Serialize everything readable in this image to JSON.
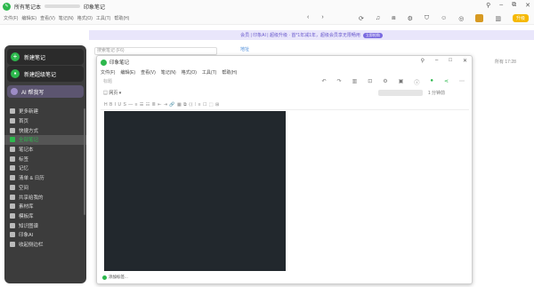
{
  "app": {
    "title": "所有笔记本",
    "window_title": "印象笔记"
  },
  "menu": [
    "文件(F)",
    "编辑(E)",
    "查看(V)",
    "笔记(N)",
    "格式(O)",
    "工具(T)",
    "帮助(H)"
  ],
  "topbar": {
    "upgrade": "升级"
  },
  "banner": {
    "text": "会员 | 印象AI | 超级升级 · 首*1年减1年，超级会员享无限畅用",
    "tag": "立即抢购"
  },
  "sidebar": {
    "new_note": "新建笔记",
    "new_super_note": "新建超级笔记",
    "ai": "AI 帮我写",
    "items": [
      "更多新建",
      "首页",
      "快捷方式",
      "全部笔记",
      "笔记本",
      "标签",
      "记忆",
      "清单 & 日历",
      "空间",
      "共享给我的",
      "素材库",
      "模板库",
      "知识图谱",
      "印象AI",
      "收起侧边栏"
    ]
  },
  "search": {
    "placeholder": "搜索笔记 (F6)"
  },
  "list": {
    "title": "地址"
  },
  "editor": {
    "title": "印象笔记",
    "menu": [
      "文件(F)",
      "编辑(E)",
      "查看(V)",
      "笔记(N)",
      "格式(O)",
      "工具(T)",
      "帮助(H)"
    ],
    "placeholder": "标题",
    "web_label": "网页",
    "read_time": "1 分钟前",
    "format_icons": "H  B  I  U  S  —  ≡  ☰  ☷  ≣  ⇤  ⇥  🔗  ▦  ⧉  ⟨⟩  ⁞  ≡  ☐  ⬚  ⊞",
    "footer": "添加标签..."
  },
  "right": {
    "text": "所有 17:28"
  }
}
